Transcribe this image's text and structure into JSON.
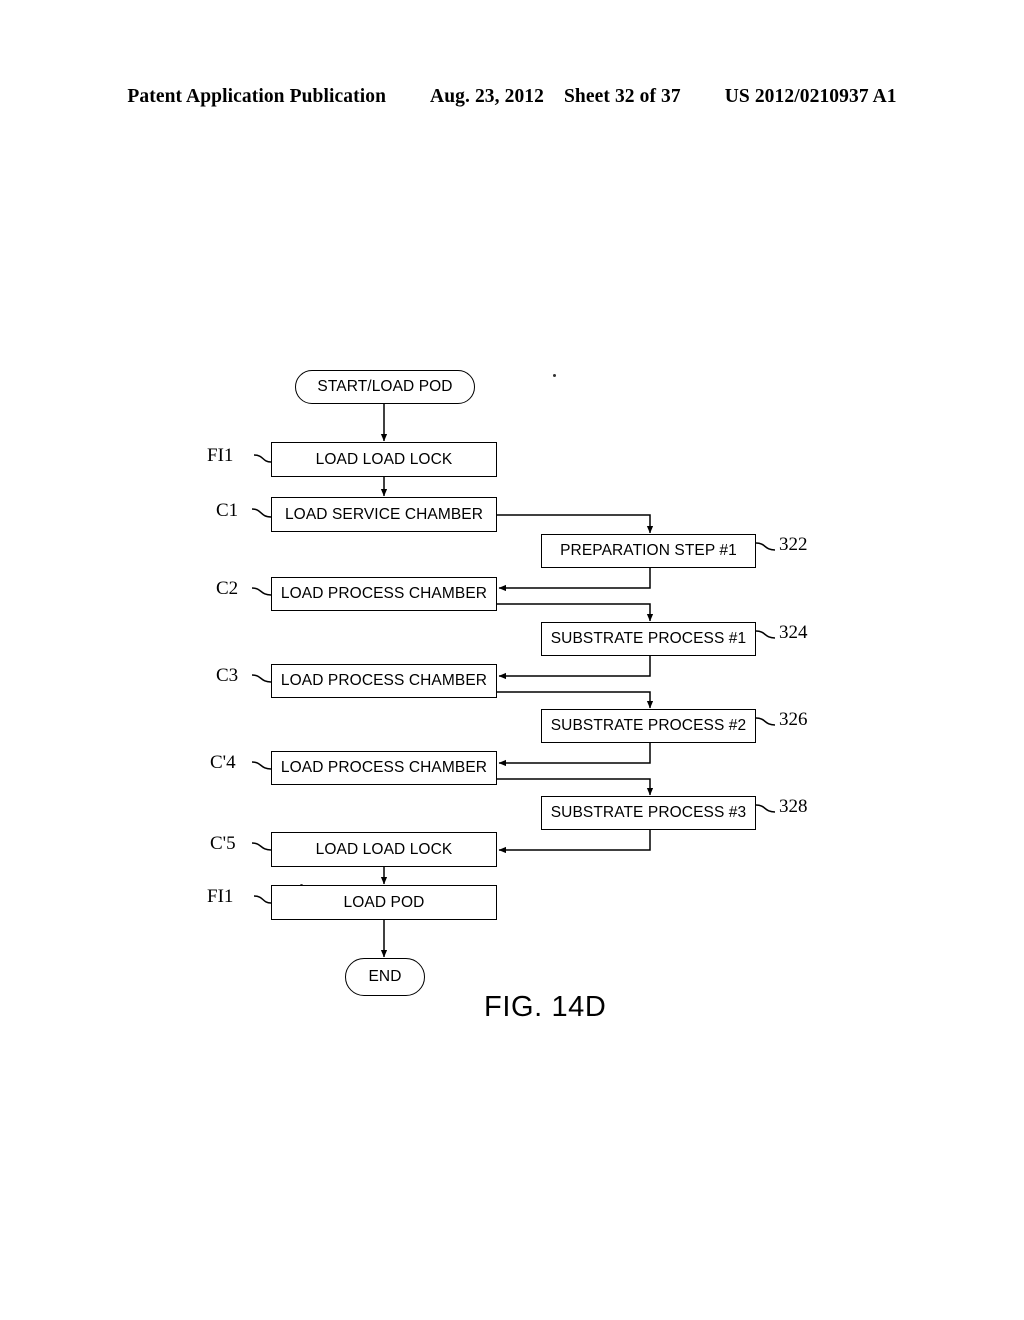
{
  "header": {
    "publication": "Patent Application Publication",
    "date": "Aug. 23, 2012",
    "sheet": "Sheet 32 of 37",
    "patent_number": "US 2012/0210937 A1"
  },
  "figure": {
    "caption": "FIG. 14D",
    "nodes": {
      "start": "START/LOAD POD",
      "load_load_lock_1": "LOAD LOAD LOCK",
      "load_service_chamber": "LOAD SERVICE CHAMBER",
      "preparation_step_1": "PREPARATION STEP #1",
      "load_process_chamber_1": "LOAD PROCESS CHAMBER",
      "substrate_process_1": "SUBSTRATE PROCESS #1",
      "load_process_chamber_2": "LOAD PROCESS CHAMBER",
      "substrate_process_2": "SUBSTRATE PROCESS #2",
      "load_process_chamber_3": "LOAD PROCESS CHAMBER",
      "substrate_process_3": "SUBSTRATE PROCESS #3",
      "load_load_lock_2": "LOAD LOAD LOCK",
      "load_pod": "LOAD POD",
      "end": "END"
    },
    "side_labels": {
      "fi1_top": "FI1",
      "c1": "C1",
      "c2": "C2",
      "c3": "C3",
      "c4": "C'4",
      "c5": "C'5",
      "fi1_bottom": "FI1"
    },
    "reference_numerals": {
      "preparation_step_1": "322",
      "substrate_process_1": "324",
      "substrate_process_2": "326",
      "substrate_process_3": "328"
    }
  }
}
